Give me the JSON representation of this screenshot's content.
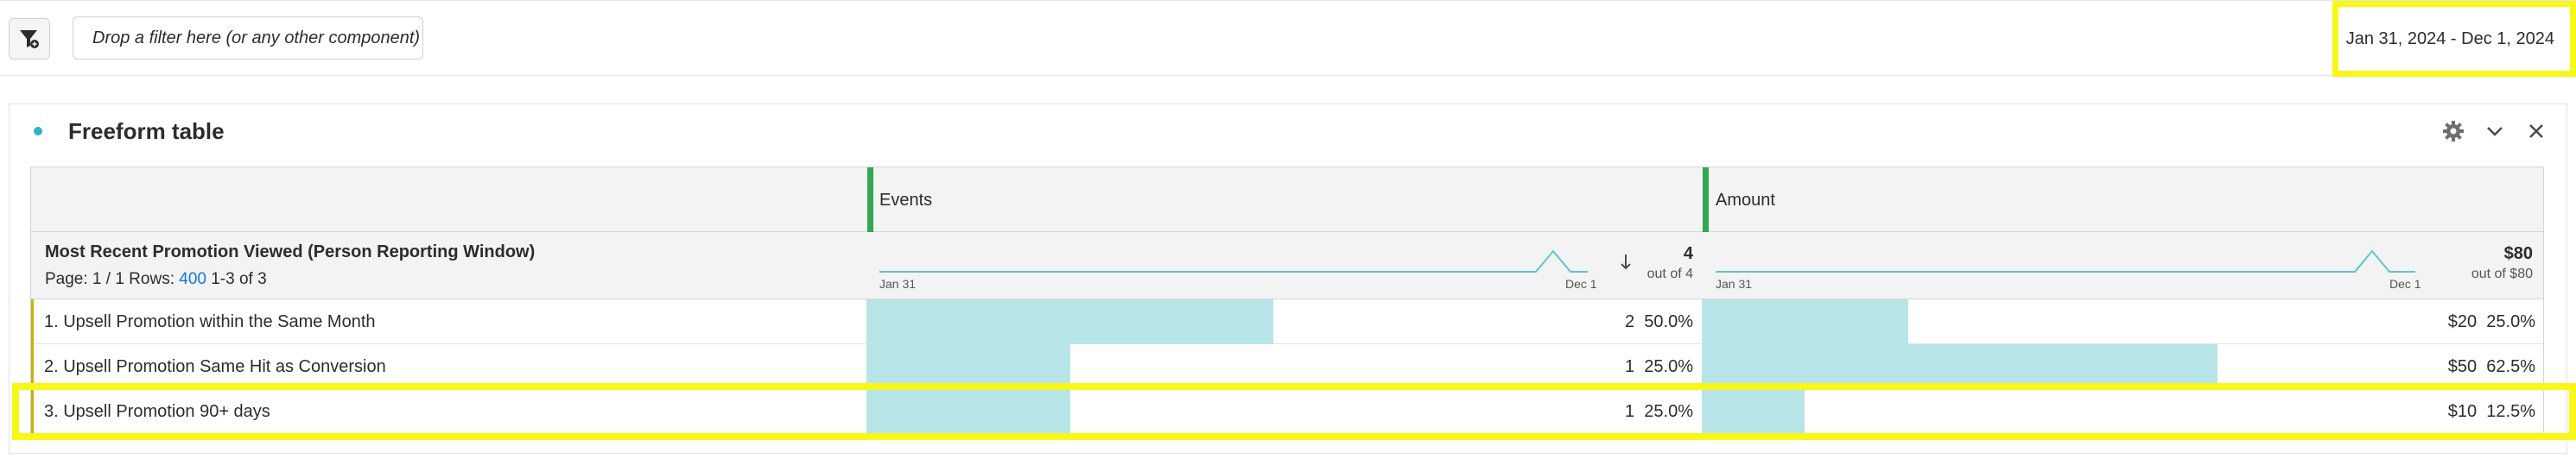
{
  "toolbar": {
    "filter_icon": "filter-add-icon",
    "dropzone_text": "Drop a filter here (or any other component)",
    "date_range": "Jan 31, 2024 - Dec 1, 2024"
  },
  "panel": {
    "title": "Freeform table",
    "icons": [
      "gear-icon",
      "chevron-down-icon",
      "close-icon"
    ]
  },
  "table": {
    "dimension_title": "Most Recent Promotion Viewed (Person Reporting Window)",
    "pager_prefix": "Page: 1 / 1  Rows:",
    "rows_per_page": "400",
    "range_text": "1-3 of 3",
    "columns": [
      {
        "name": "Events",
        "total": "4",
        "total_sub": "out of 4",
        "spark_start": "Jan 31",
        "spark_end": "Dec 1"
      },
      {
        "name": "Amount",
        "total": "$80",
        "total_sub": "out of $80",
        "spark_start": "Jan 31",
        "spark_end": "Dec 1"
      }
    ],
    "rows": [
      {
        "label": "1.  Upsell Promotion within the Same Month",
        "events_val": "2",
        "events_pct": "50.0%",
        "events_frac": 0.5,
        "amount_val": "$20",
        "amount_pct": "25.0%",
        "amount_frac": 0.25
      },
      {
        "label": "2.  Upsell Promotion Same Hit as Conversion",
        "events_val": "1",
        "events_pct": "25.0%",
        "events_frac": 0.25,
        "amount_val": "$50",
        "amount_pct": "62.5%",
        "amount_frac": 0.625
      },
      {
        "label": "3.  Upsell Promotion 90+ days",
        "events_val": "1",
        "events_pct": "25.0%",
        "events_frac": 0.25,
        "amount_val": "$10",
        "amount_pct": "12.5%",
        "amount_frac": 0.125
      }
    ]
  },
  "colors": {
    "accent": "#2fb3c3",
    "bar": "#b8e5e7",
    "highlight": "#f7f718",
    "metric_grip": "#33a852"
  }
}
